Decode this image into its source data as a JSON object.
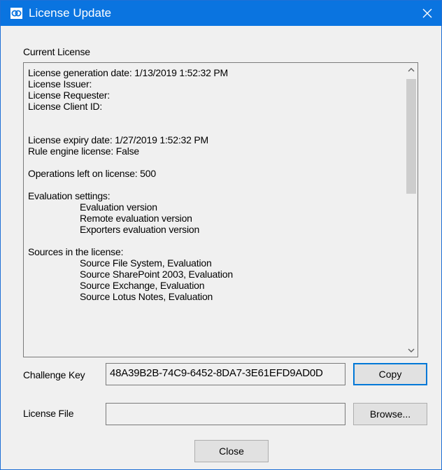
{
  "window": {
    "title": "License Update",
    "icons": {
      "app": "link-app-icon",
      "close": "close-icon"
    }
  },
  "current_license": {
    "label": "Current License",
    "lines": [
      "License generation date: 1/13/2019 1:52:32 PM",
      "License Issuer:",
      "License Requester:",
      "License Client ID:",
      "",
      "",
      "License expiry date: 1/27/2019 1:52:32 PM",
      "Rule engine license: False",
      "",
      "Operations left on license: 500",
      "",
      "Evaluation settings:",
      "Evaluation version",
      "Remote evaluation version",
      "Exporters evaluation version",
      "",
      "Sources in the license:",
      "Source File System, Evaluation",
      "Source SharePoint 2003, Evaluation",
      "Source Exchange, Evaluation",
      "Source Lotus Notes, Evaluation"
    ]
  },
  "challenge_key": {
    "label": "Challenge Key",
    "value": "48A39B2B-74C9-6452-8DA7-3E61EFD9AD0D",
    "copy_button": "Copy"
  },
  "license_file": {
    "label": "License File",
    "value": "",
    "browse_button": "Browse..."
  },
  "footer": {
    "close_button": "Close"
  }
}
